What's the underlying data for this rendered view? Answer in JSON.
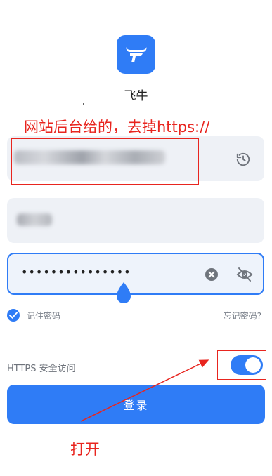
{
  "app": {
    "name": "飞牛",
    "logo_icon": "fnos-bull-logo",
    "accent": "#2f7cf6"
  },
  "annotations": {
    "top_note": "网站后台给的，去掉https://",
    "bottom_note": "打开",
    "color": "#e8251f"
  },
  "form": {
    "server_field": {
      "value": "",
      "icon": "history-icon",
      "blurred": true
    },
    "username_field": {
      "value": "",
      "blurred": true
    },
    "password_field": {
      "masked_value": "•••••••••••••••",
      "clear_icon": "clear-icon",
      "visibility_icon": "eye-off-icon"
    },
    "remember": {
      "label": "记住密码",
      "checked": true
    },
    "forgot_link": "忘记密码?",
    "https": {
      "label": "HTTPS 安全访问",
      "enabled": true
    },
    "login_button": "登录"
  }
}
